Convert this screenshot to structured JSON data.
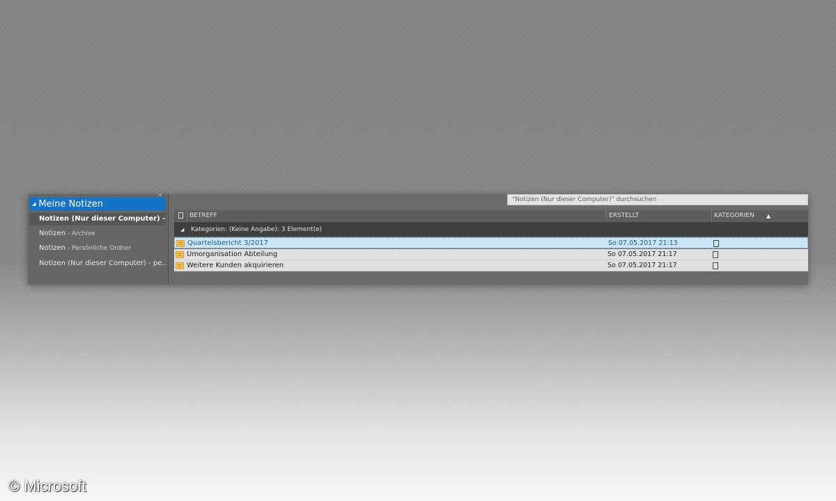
{
  "sidebar": {
    "header": "Meine Notizen",
    "collapse_icon": "chevron-left-icon",
    "items": [
      {
        "label": "Notizen (Nur dieser Computer) -...",
        "suffix": "",
        "selected": true
      },
      {
        "label": "Notizen",
        "suffix": " - Archive",
        "selected": false
      },
      {
        "label": "Notizen",
        "suffix": " - Persönliche Ordner",
        "selected": false
      },
      {
        "label": "Notizen (Nur dieser Computer) - pe...",
        "suffix": "",
        "selected": false
      }
    ]
  },
  "search": {
    "placeholder": "\"Notizen (Nur dieser Computer)\" durchsuchen"
  },
  "columns": {
    "subject": "BETREFF",
    "created": "ERSTELLT",
    "categories": "KATEGORIEN",
    "sort_indicator": "▲"
  },
  "group": {
    "label": "Kategorien: (Keine Angabe): 3 Element(e)",
    "expand_icon": "triangle-down-icon"
  },
  "rows": [
    {
      "subject": "Quartelsbericht 3/2017",
      "created": "So 07.05.2017 21:13",
      "selected": true
    },
    {
      "subject": "Umorganisation Abteilung",
      "created": "So 07.05.2017 21:17",
      "selected": false
    },
    {
      "subject": "Weitere Kunden akquirieren",
      "created": "So 07.05.2017 21:17",
      "selected": false
    }
  ],
  "colors": {
    "accent": "#1473c7",
    "selected_row": "#c9e5f6",
    "note_icon": "#f3c04f"
  },
  "watermark": "© Microsoft"
}
